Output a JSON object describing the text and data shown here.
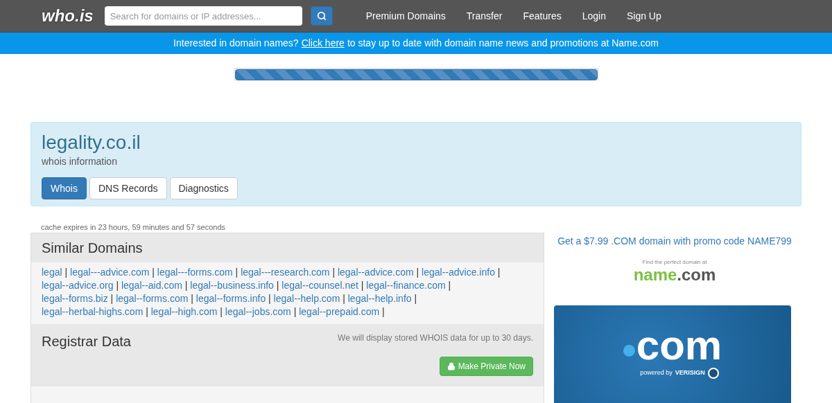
{
  "nav": {
    "logo": "who.is",
    "search": {
      "placeholder": "Search for domains or IP addresses..."
    },
    "links": [
      "Premium Domains",
      "Transfer",
      "Features",
      "Login",
      "Sign Up"
    ]
  },
  "banner": {
    "before": "Interested in domain names?",
    "link": "Click here",
    "after": "to stay up to date with domain name news and promotions at Name.com"
  },
  "progress": {
    "level": 1
  },
  "header": {
    "domain": "legality.co.il",
    "subtitle": "whois information",
    "tabs": [
      {
        "label": "Whois",
        "selected": true
      },
      {
        "label": "DNS Records",
        "selected": false
      },
      {
        "label": "Diagnostics",
        "selected": false
      }
    ]
  },
  "cache_note": "cache expires in 23 hours, 59 minutes and 57 seconds",
  "similar": {
    "title": "Similar Domains",
    "separator": "|",
    "domains": [
      "legal",
      "legal---advice.com",
      "legal---forms.com",
      "legal---research.com",
      "legal--advice.com",
      "legal--advice.info",
      "legal--advice.org",
      "legal--aid.com",
      "legal--business.info",
      "legal--counsel.net",
      "legal--finance.com",
      "legal--forms.biz",
      "legal--forms.com",
      "legal--forms.info",
      "legal--help.com",
      "legal--help.info",
      "legal--herbal-highs.com",
      "legal--high.com",
      "legal--jobs.com",
      "legal--prepaid.com"
    ]
  },
  "registrar": {
    "title": "Registrar Data",
    "note": "We will display stored WHOIS data for up to 30 days.",
    "button": "Make Private Now"
  },
  "sidebar": {
    "promo": "Get a $7.99 .COM domain with promo code NAME799",
    "ad_tagline": "Find the perfect domain at",
    "ad_brand_a": "name",
    "ad_brand_b": ".com",
    "com_ad": {
      "big": "com",
      "powered": "powered by",
      "brand": "VERISIGN"
    }
  }
}
